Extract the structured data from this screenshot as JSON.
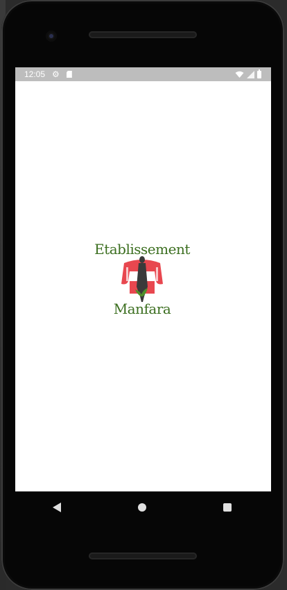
{
  "status_bar": {
    "time": "12:05",
    "icons": [
      "gear-icon",
      "sd-card-icon",
      "wifi-icon",
      "signal-icon",
      "battery-icon"
    ]
  },
  "splash": {
    "logo_text_top": "Etablissement",
    "logo_text_bottom": "Manfara",
    "logo_colors": {
      "text": "#3b6e1f",
      "sofa": "#e8474f",
      "figure": "#3a3a3a",
      "leaf": "#4f8f2a"
    }
  },
  "nav_bar": {
    "buttons": [
      "back-icon",
      "home-icon",
      "recents-icon"
    ]
  },
  "colors": {
    "status_bar_bg": "#bdbdbd",
    "screen_bg": "#ffffff",
    "device_bezel": "#060606"
  }
}
